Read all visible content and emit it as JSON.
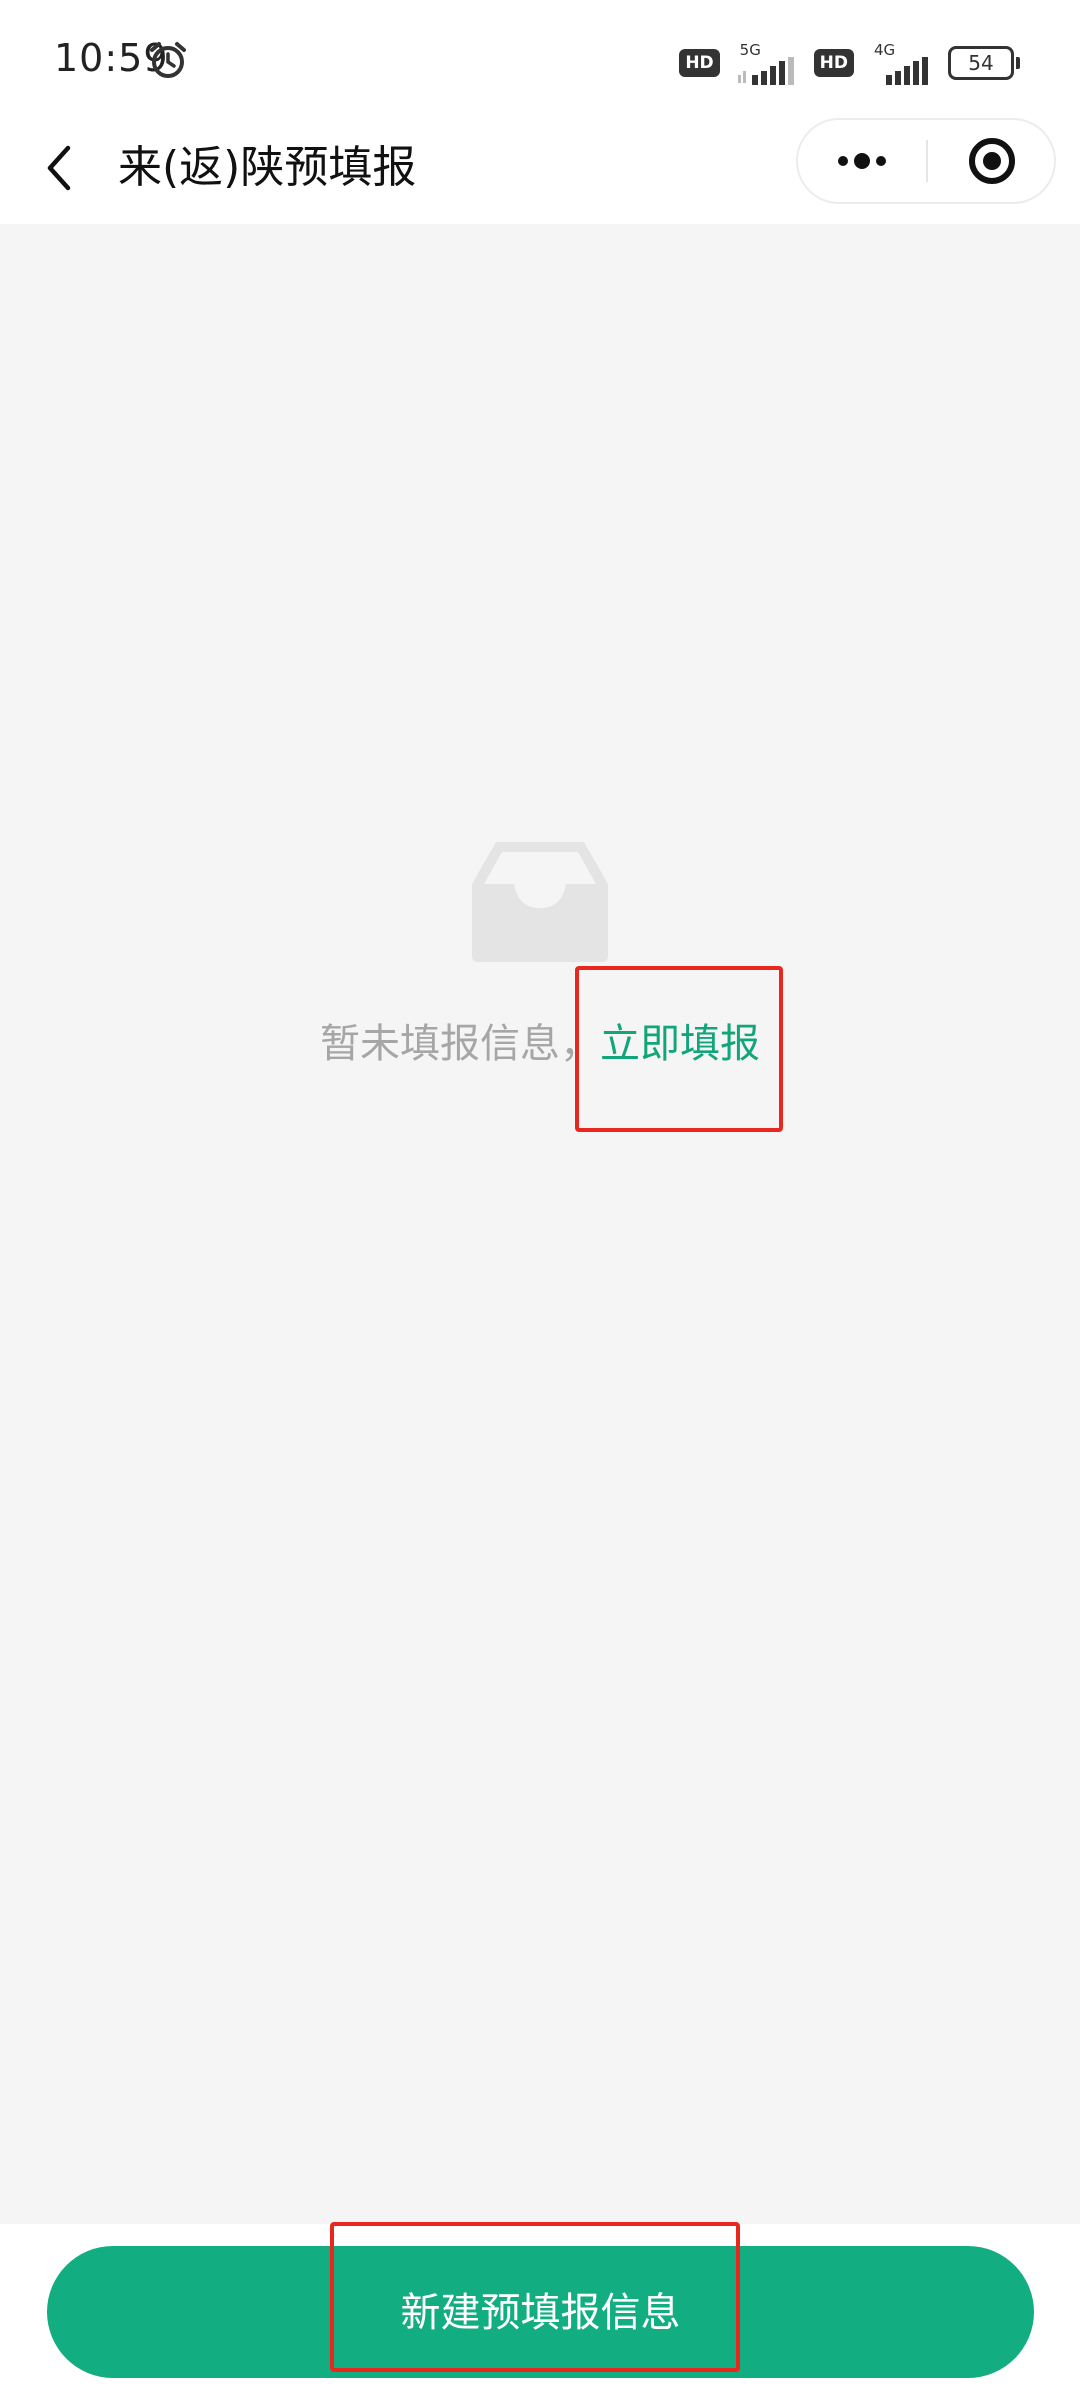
{
  "status_bar": {
    "time": "10:59",
    "hd_label_1": "HD",
    "network_1": "5G",
    "hd_label_2": "HD",
    "network_2": "4G",
    "battery": "54"
  },
  "nav": {
    "title": "来(返)陕预填报"
  },
  "empty_state": {
    "message": "暂未填报信息，",
    "link": "立即填报"
  },
  "bottom": {
    "button_label": "新建预填报信息"
  },
  "colors": {
    "accent": "#12ae82",
    "link": "#12a57a",
    "background": "#f5f5f5",
    "highlight": "#e8281f"
  }
}
